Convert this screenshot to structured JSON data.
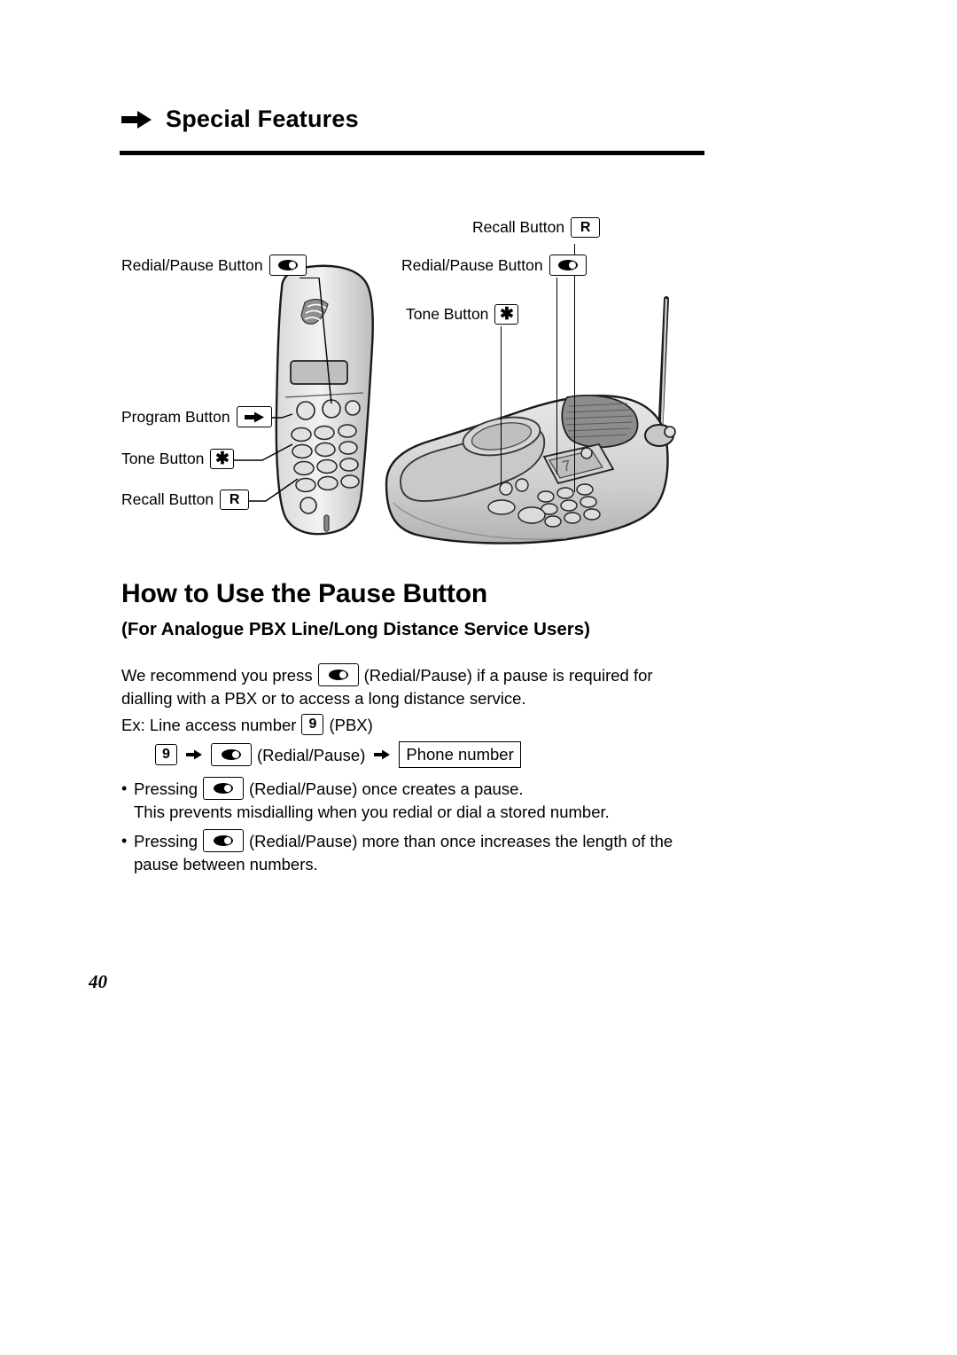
{
  "header": {
    "title": "Special Features",
    "arrow_icon": "right-arrow-icon"
  },
  "diagram": {
    "labels": [
      {
        "id": "handset-redial",
        "text": "Redial/Pause Button",
        "key": "redial-pause-glyph"
      },
      {
        "id": "handset-program",
        "text": "Program Button",
        "key": "program-arrow-glyph"
      },
      {
        "id": "handset-tone",
        "text": "Tone Button",
        "key": "*"
      },
      {
        "id": "handset-recall",
        "text": "Recall Button",
        "key": "R"
      },
      {
        "id": "base-recall",
        "text": "Recall Button",
        "key": "R"
      },
      {
        "id": "base-redial",
        "text": "Redial/Pause Button",
        "key": "redial-pause-glyph"
      },
      {
        "id": "base-tone",
        "text": "Tone Button",
        "key": "*"
      }
    ],
    "illustration_name": "cordless-phone-handset-and-base-illustration"
  },
  "section": {
    "title": "How to Use the Pause Button",
    "subtitle": "(For Analogue PBX Line/Long Distance Service Users)"
  },
  "body": {
    "para1_a": "We recommend you press",
    "para1_b": "(Redial/Pause) if a pause is required for",
    "para1_c": "dialling with a PBX or to access a long distance service.",
    "example_prefix": "Ex: Line access number",
    "example_key": "9",
    "example_suffix": "(PBX)",
    "seq_key1": "9",
    "seq_label_redial": "(Redial/Pause)",
    "seq_phone_number": "Phone number",
    "bullet1_a": "Pressing",
    "bullet1_b": "(Redial/Pause) once creates a pause.",
    "bullet1_c": "This prevents misdialling when you redial or dial a stored number.",
    "bullet2_a": "Pressing",
    "bullet2_b": "(Redial/Pause) more than once increases the length of the",
    "bullet2_c": "pause between numbers."
  },
  "footer": {
    "page_number": "40"
  }
}
